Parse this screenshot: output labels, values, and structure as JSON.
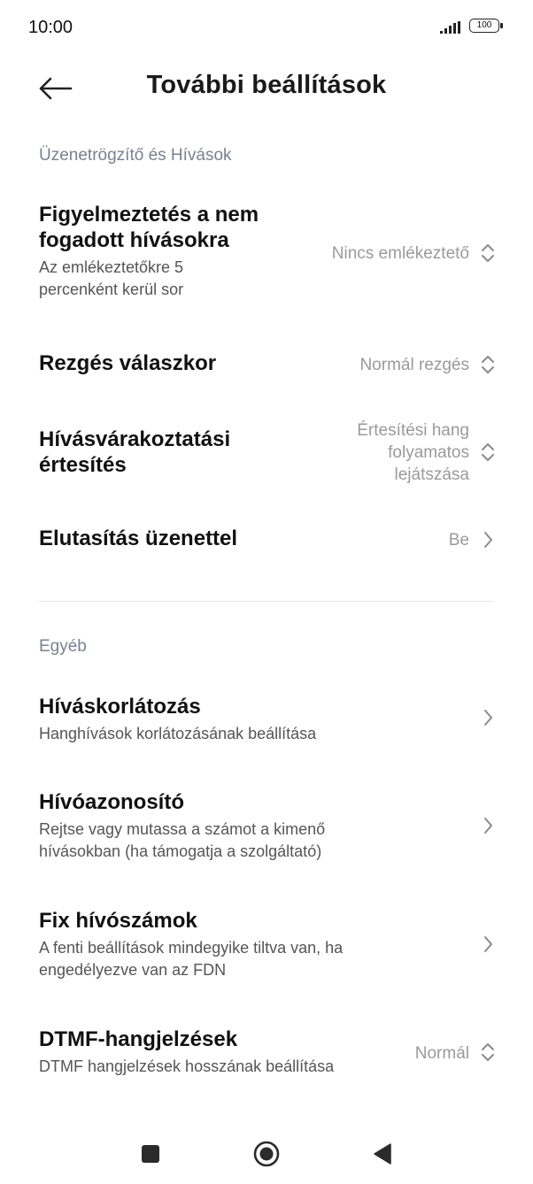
{
  "status_bar": {
    "time": "10:00",
    "battery": "100"
  },
  "header": {
    "title": "További beállítások"
  },
  "sections": {
    "voicemail": {
      "title": "Üzenetrögzítő és Hívások"
    },
    "other": {
      "title": "Egyéb"
    }
  },
  "items": {
    "missed_call_alert": {
      "title_line1": "Figyelmeztetés a nem",
      "title_line2": "fogadott hívásokra",
      "subtitle_line1": "Az emlékeztetőkre 5",
      "subtitle_line2": "percenként kerül sor",
      "value": "Nincs emlékeztető"
    },
    "vibrate_on_answer": {
      "title": "Rezgés válaszkor",
      "value": "Normál rezgés"
    },
    "call_waiting_alert": {
      "title_line1": "Hívásvárakoztatási",
      "title_line2": "értesítés",
      "value_line1": "Értesítési hang",
      "value_line2": "folyamatos",
      "value_line3": "lejátszása"
    },
    "reject_with_message": {
      "title": "Elutasítás üzenettel",
      "value": "Be"
    },
    "call_barring": {
      "title": "Híváskorlátozás",
      "subtitle": "Hanghívások korlátozásának beállítása"
    },
    "caller_id": {
      "title": "Hívóazonosító",
      "subtitle_line1": "Rejtse vagy mutassa a számot a kimenő",
      "subtitle_line2": "hívásokban (ha támogatja a szolgáltató)"
    },
    "fixed_dialing": {
      "title": "Fix hívószámok",
      "subtitle_line1": "A fenti beállítások mindegyike tiltva van, ha",
      "subtitle_line2": "engedélyezve van az FDN"
    },
    "dtmf_tones": {
      "title": "DTMF-hangjelzések",
      "subtitle": "DTMF hangjelzések hosszának beállítása",
      "value": "Normál"
    }
  }
}
